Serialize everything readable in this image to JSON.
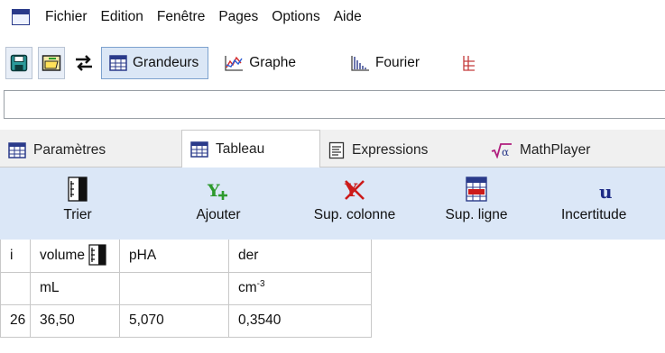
{
  "menu": [
    "Fichier",
    "Edition",
    "Fenêtre",
    "Pages",
    "Options",
    "Aide"
  ],
  "toolbar": {
    "grandeurs": "Grandeurs",
    "graphe": "Graphe",
    "fourier": "Fourier"
  },
  "address": {
    "value": ""
  },
  "tabs": [
    "Paramètres",
    "Tableau",
    "Expressions",
    "MathPlayer"
  ],
  "ribbon": [
    "Trier",
    "Ajouter",
    "Sup. colonne",
    "Sup. ligne",
    "Incertitude"
  ],
  "table": {
    "headers": [
      "i",
      "volume",
      "pHA",
      "der"
    ],
    "units": [
      "",
      "mL",
      "",
      "cm"
    ],
    "unit_exponent": "-3",
    "rows": [
      [
        "26",
        "36,50",
        "5,070",
        "0,3540"
      ]
    ]
  },
  "colors": {
    "ribbon_bg": "#dbe7f7",
    "active_button_bg": "#dbe7f6",
    "tabs_bg": "#f0f0f0",
    "icon_blue": "#2a3a8a",
    "add_green": "#2d9a2d",
    "delete_red": "#cc1a1a",
    "uncertainty_navy": "#1d2b86"
  }
}
